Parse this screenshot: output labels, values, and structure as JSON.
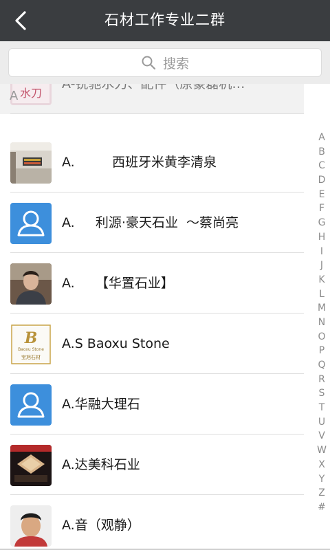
{
  "header": {
    "title": "石材工作专业二群",
    "back_icon": "chevron-left-icon"
  },
  "search": {
    "placeholder": "搜索",
    "icon": "search-icon"
  },
  "contacts": [
    {
      "name": "A-锐驰水刀、配件（原豪磊机…",
      "avatar": "photo",
      "avatar_text": "锐驰\n水刀",
      "section_letter": "A"
    },
    {
      "name": "A.         西班牙米黄李清泉",
      "avatar": "photo"
    },
    {
      "name": "A.     利源·豪天石业  ～蔡尚亮",
      "avatar": "default-person-icon"
    },
    {
      "name": "A.     【华置石业】",
      "avatar": "photo"
    },
    {
      "name": "A.S Baoxu Stone",
      "avatar": "logo",
      "logo_text": "Baoxu Stone",
      "logo_sub": "宝旭石材"
    },
    {
      "name": "A.华融大理石",
      "avatar": "default-person-icon"
    },
    {
      "name": "A.达美科石业",
      "avatar": "photo"
    },
    {
      "name": "A.音（观静）",
      "avatar": "photo"
    }
  ],
  "index_letters": [
    "A",
    "B",
    "C",
    "D",
    "E",
    "F",
    "G",
    "H",
    "I",
    "J",
    "K",
    "L",
    "M",
    "N",
    "O",
    "P",
    "Q",
    "R",
    "S",
    "T",
    "U",
    "V",
    "W",
    "X",
    "Y",
    "Z",
    "#"
  ],
  "colors": {
    "titlebar": "#3a3d40",
    "default_avatar": "#3d8fdc",
    "search_bg": "#ececec"
  }
}
